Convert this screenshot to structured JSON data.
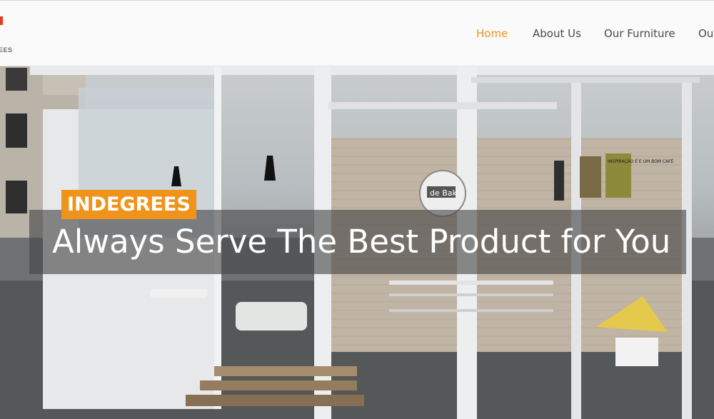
{
  "logo": {
    "text": "EES"
  },
  "nav": {
    "items": [
      {
        "label": "Home",
        "active": true
      },
      {
        "label": "About Us",
        "active": false
      },
      {
        "label": "Our Furniture",
        "active": false
      },
      {
        "label": "Ou",
        "active": false
      }
    ]
  },
  "hero": {
    "badge": "INDEGREES",
    "headline": "Always Serve The Best Product for You",
    "store_sign": "de Bak",
    "poster_text": "INSPIRAÇÃO É E UM BOM CAFÉ"
  },
  "colors": {
    "accent": "#f0941c",
    "badge_bg": "#f0931b",
    "logo_red": "#e53b1e",
    "nav_text": "#4a4a4a"
  }
}
